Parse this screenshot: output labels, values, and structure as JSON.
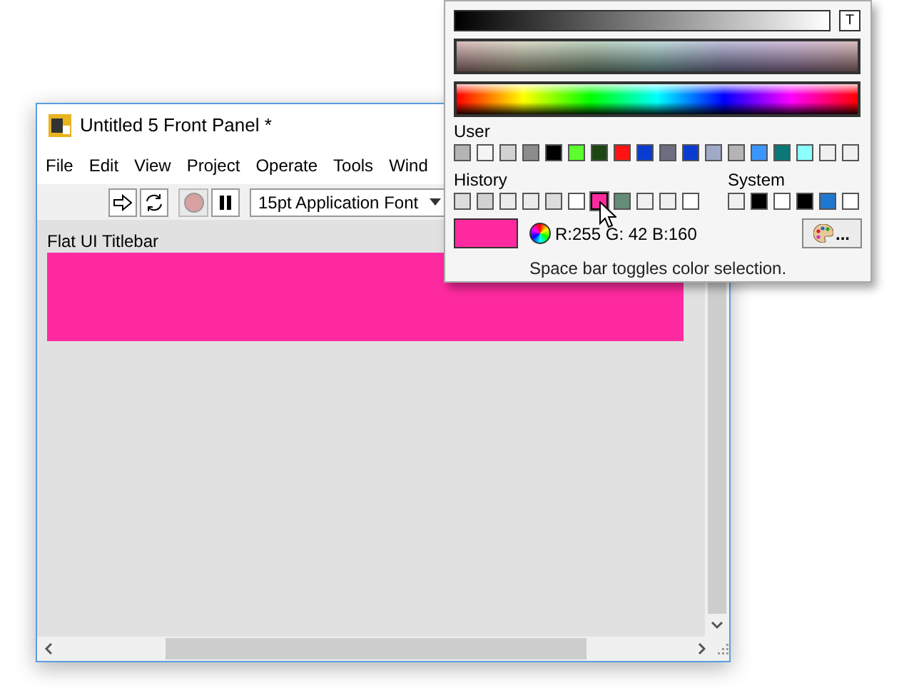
{
  "window": {
    "title": "Untitled 5 Front Panel *"
  },
  "menu": [
    "File",
    "Edit",
    "View",
    "Project",
    "Operate",
    "Tools",
    "Wind"
  ],
  "toolbar": {
    "font_select": "15pt Application Font"
  },
  "panel": {
    "label": "Flat UI Titlebar"
  },
  "color_picker": {
    "user_label": "User",
    "user": [
      {
        "color": "#b4b4b4"
      },
      {
        "color": "#f5f5f5"
      },
      {
        "color": "#d2d2d2"
      },
      {
        "color": "#8c8c8c"
      },
      {
        "color": "#000000"
      },
      {
        "color": "#5aff2d"
      },
      {
        "color": "#1e4614"
      },
      {
        "color": "#ff1414"
      },
      {
        "color": "#0a3cd2"
      },
      {
        "color": "#6e6e82"
      },
      {
        "color": "#0a3cd2"
      },
      {
        "color": "#a0aac8"
      },
      {
        "color": "#b4b4b4"
      },
      {
        "color": "#3c96ff"
      },
      {
        "color": "#0a7878"
      },
      {
        "color": "#8cffff"
      },
      {
        "color": "#f0f0f0"
      },
      {
        "color": "#f0f0f0"
      }
    ],
    "history_label": "History",
    "history": [
      {
        "color": "#dcdcdc",
        "selected": false
      },
      {
        "color": "#d2d2d2",
        "selected": false
      },
      {
        "color": "#ebebeb",
        "selected": false
      },
      {
        "color": "#ebebeb",
        "selected": false
      },
      {
        "color": "#dcdcdc",
        "selected": false
      },
      {
        "color": "#ffffff",
        "selected": false
      },
      {
        "color": "#ff2aa0",
        "selected": true
      },
      {
        "color": "#648c78",
        "selected": false
      },
      {
        "color": "#f0f0f0",
        "selected": false
      },
      {
        "color": "#f0f0f0",
        "selected": false
      },
      {
        "color": "#ffffff",
        "selected": false
      }
    ],
    "system_label": "System",
    "system": [
      {
        "color": "#f0f0f0"
      },
      {
        "color": "#000000"
      },
      {
        "color": "#ffffff"
      },
      {
        "color": "#000000"
      },
      {
        "color": "#1e78d2"
      },
      {
        "color": "#ffffff"
      }
    ],
    "transparent_button": "T",
    "rgb_reading": "R:255 G: 42 B:160",
    "more_button": "...",
    "hint": "Space bar toggles color selection."
  }
}
